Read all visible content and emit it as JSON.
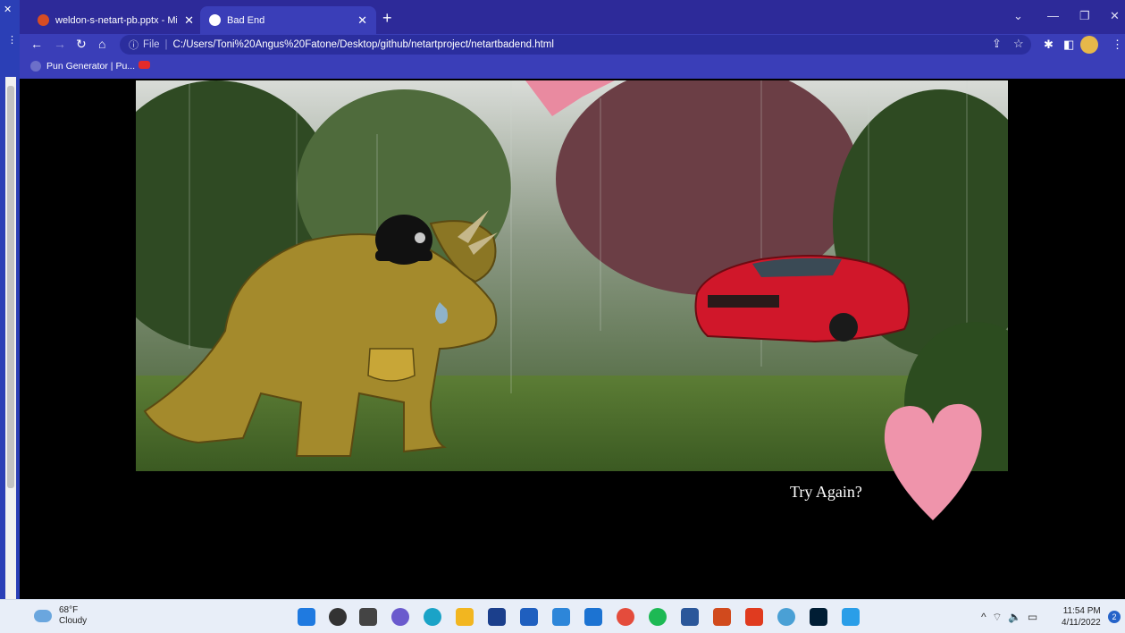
{
  "browser": {
    "tabs": [
      {
        "label": "weldon-s-netart-pb.pptx - Micros",
        "active": false
      },
      {
        "label": "Bad End",
        "active": true
      }
    ],
    "url_scheme": "File",
    "url_path": "C:/Users/Toni%20Angus%20Fatone/Desktop/github/netartproject/netartbadend.html",
    "bookmarks": [
      {
        "label": "Pun Generator | Pu..."
      },
      {
        "label": ""
      }
    ]
  },
  "page": {
    "link_text": "Try Again?",
    "scene_description_icons": [
      "triceratops",
      "police-helmet",
      "sheriff-badge",
      "teardrop",
      "red-sports-car",
      "pink-heart"
    ]
  },
  "taskbar": {
    "weather_temp": "68°F",
    "weather_desc": "Cloudy",
    "time": "11:54 PM",
    "date": "4/11/2022",
    "notification_count": "2"
  },
  "colors": {
    "chrome_tabbar": "#2d2a99",
    "chrome_toolbar": "#3a3eb8",
    "taskbar": "#e8eef8",
    "page_bg": "#000000"
  }
}
